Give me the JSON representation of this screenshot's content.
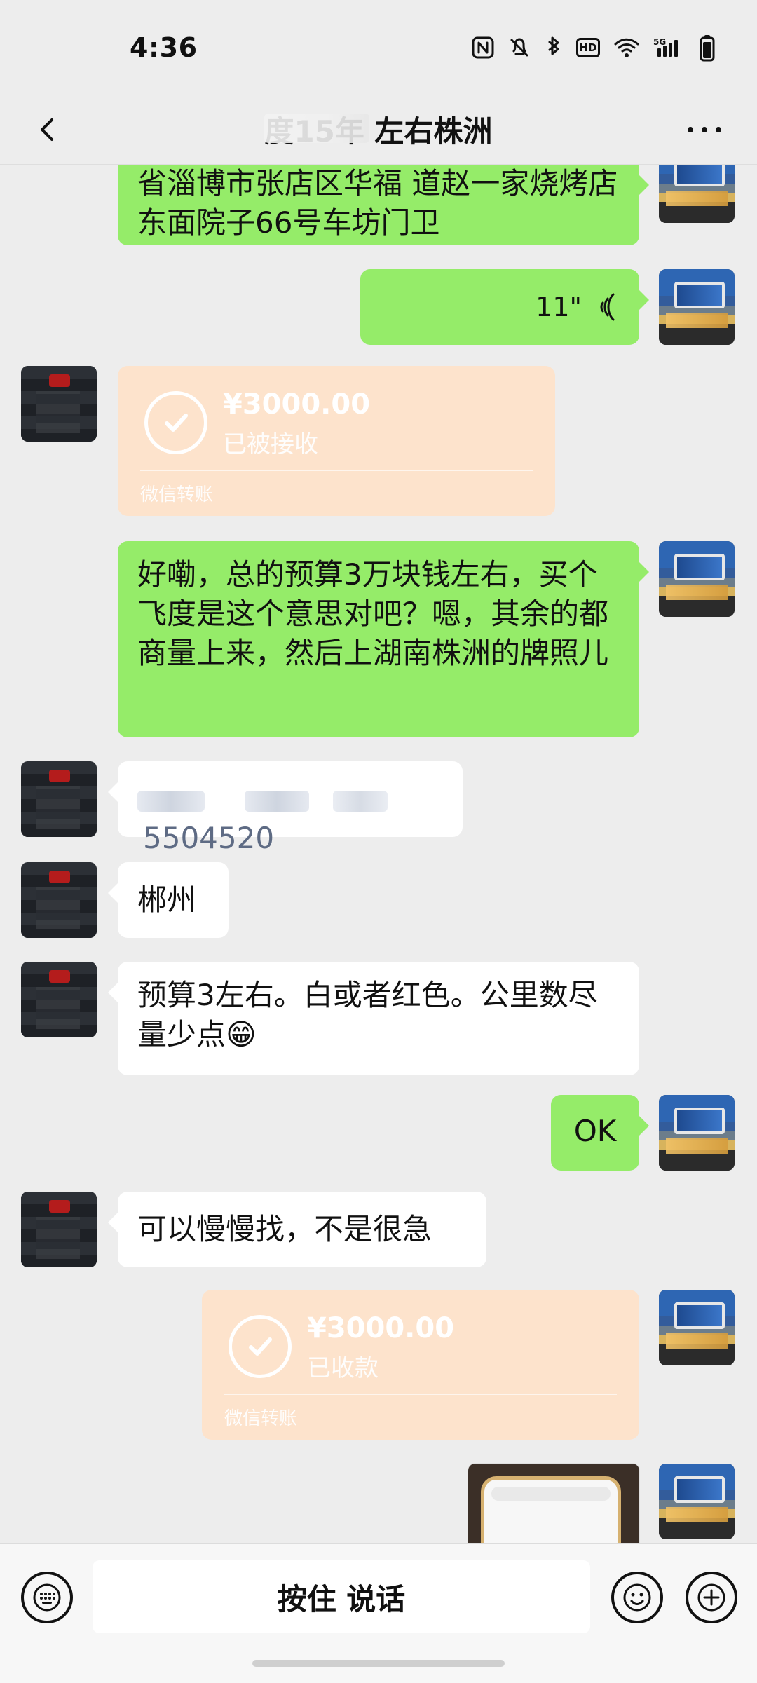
{
  "status_bar": {
    "time": "4:36",
    "icons": [
      "nfc-icon",
      "mute-icon",
      "bluetooth-icon",
      "hd-icon",
      "wifi-icon",
      "5g-signal-icon",
      "battery-icon"
    ],
    "hd_label": "HD"
  },
  "top_bar": {
    "title": "度15年 左右株洲",
    "back_icon": "chevron-left-icon",
    "more_icon": "more-dots-icon"
  },
  "messages": [
    {
      "type": "text",
      "side": "right",
      "text": "省淄博市张店区华福 道赵一家烧烤店东面院子66号车坊门卫"
    },
    {
      "type": "voice",
      "side": "right",
      "duration": "11\""
    },
    {
      "type": "transfer",
      "side": "left",
      "amount": "¥3000.00",
      "status": "已被接收",
      "label": "微信转账"
    },
    {
      "type": "text",
      "side": "right",
      "text": "好嘞，总的预算3万块钱左右，买个飞度是这个意思对吧？嗯，其余的都商量上来，然后上湖南株洲的牌照儿"
    },
    {
      "type": "text",
      "side": "left",
      "text": "5504520",
      "redacted_prefix": true
    },
    {
      "type": "text",
      "side": "left",
      "text": "郴州"
    },
    {
      "type": "text",
      "side": "left",
      "text": "预算3左右。白或者红色。公里数尽量少点😁"
    },
    {
      "type": "text",
      "side": "right",
      "text": "OK"
    },
    {
      "type": "text",
      "side": "left",
      "text": "可以慢慢找，不是很急"
    },
    {
      "type": "transfer",
      "side": "right",
      "amount": "¥3000.00",
      "status": "已收款",
      "label": "微信转账"
    },
    {
      "type": "image",
      "side": "right",
      "caption": ""
    }
  ],
  "bottom_bar": {
    "hold_to_talk": "按住 说话",
    "keyboard_icon": "keyboard-icon",
    "emoji_icon": "emoji-icon",
    "add_icon": "plus-circle-icon"
  }
}
